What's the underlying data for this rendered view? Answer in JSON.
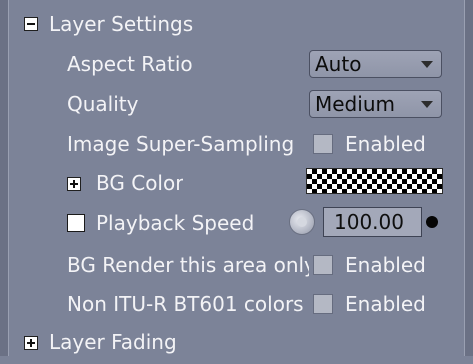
{
  "panel": {
    "sections": {
      "layer_settings": {
        "label": "Layer Settings",
        "expanded": true
      },
      "layer_fading": {
        "label": "Layer Fading",
        "expanded": false
      }
    },
    "rows": {
      "aspect_ratio": {
        "label": "Aspect Ratio",
        "value": "Auto"
      },
      "quality": {
        "label": "Quality",
        "value": "Medium"
      },
      "super_sampling": {
        "label": "Image Super-Sampling",
        "checkbox_label": "Enabled",
        "checked": false
      },
      "bg_color": {
        "label": "BG Color"
      },
      "playback_speed": {
        "label": "Playback Speed",
        "value": "100.00",
        "checked": false
      },
      "bg_render": {
        "label": "BG Render this area only",
        "checkbox_label": "Enabled",
        "checked": false
      },
      "non_itu": {
        "label": "Non ITU-R BT601 colors",
        "checkbox_label": "Enabled",
        "checked": false
      }
    }
  },
  "colors": {
    "panel_bg": "#7c8398",
    "text": "#f3f3f6"
  }
}
